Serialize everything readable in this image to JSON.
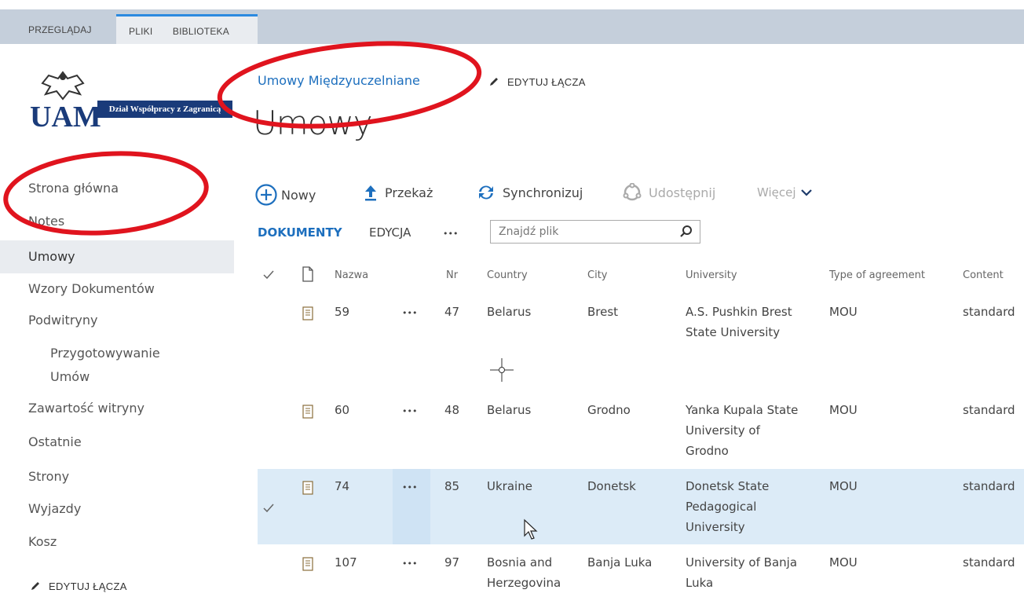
{
  "ribbon": {
    "tabs": [
      "PRZEGLĄDAJ",
      "PLIKI",
      "BIBLIOTEKA"
    ]
  },
  "logo": {
    "band_text": "Dział Współpracy z Zagranicą",
    "mark": "UAM"
  },
  "nav": {
    "items": [
      "Strona główna",
      "Notes",
      "Umowy",
      "Wzory Dokumentów",
      "Podwitryny",
      "Przygotowywanie",
      "Umów",
      "Zawartość witryny",
      "Ostatnie",
      "Strony",
      "Wyjazdy",
      "Kosz"
    ],
    "edit_links": "EDYTUJ ŁĄCZA"
  },
  "header": {
    "breadcrumb": "Umowy Międzyuczelniane",
    "edit_links": "EDYTUJ ŁĄCZA",
    "title": "Umowy"
  },
  "commands": {
    "new": "Nowy",
    "upload": "Przekaż",
    "sync": "Synchronizuj",
    "share": "Udostępnij",
    "more": "Więcej"
  },
  "views": {
    "documents": "DOKUMENTY",
    "edit": "EDYCJA",
    "ellipsis": "•••"
  },
  "search": {
    "placeholder": "Znajdź plik"
  },
  "table": {
    "columns": [
      "Nazwa",
      "Nr",
      "Country",
      "City",
      "University",
      "Type of agreement",
      "Content"
    ],
    "rows": [
      {
        "name": "59",
        "nr": "47",
        "country": "Belarus",
        "city": "Brest",
        "univ1": "A.S. Pushkin Brest",
        "univ2": "State University",
        "univ3": "",
        "type": "MOU",
        "content": "standard"
      },
      {
        "name": "60",
        "nr": "48",
        "country": "Belarus",
        "city": "Grodno",
        "univ1": "Yanka Kupala State",
        "univ2": "University of",
        "univ3": "Grodno",
        "type": "MOU",
        "content": "standard"
      },
      {
        "name": "74",
        "nr": "85",
        "country": "Ukraine",
        "city": "Donetsk",
        "univ1": "Donetsk State",
        "univ2": "Pedagogical",
        "univ3": "University",
        "type": "MOU",
        "content": "standard"
      },
      {
        "name": "107",
        "nr": "97",
        "country": "Bosnia and",
        "country2": "Herzegovina",
        "city": "Banja Luka",
        "univ1": "University of Banja",
        "univ2": "Luka",
        "univ3": "",
        "type": "MOU",
        "content": "standard"
      }
    ],
    "ellipsis": "•••"
  },
  "colors": {
    "accent": "#1d6fbe",
    "ribbon": "#c5cfdb",
    "selected_row": "#dcebf7",
    "annotation": "#e0141e"
  }
}
